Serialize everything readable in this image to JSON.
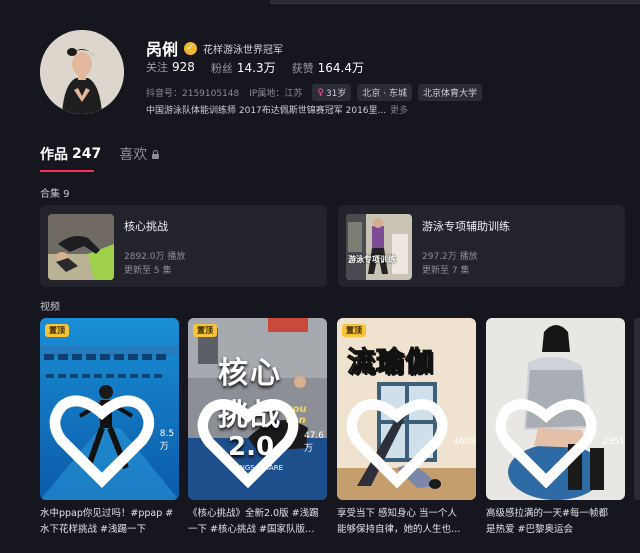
{
  "profile": {
    "name": "呙俐",
    "verified_text": "花样游泳世界冠军",
    "stats": [
      {
        "label": "关注",
        "value": "928"
      },
      {
        "label": "粉丝",
        "value": "14.3万"
      },
      {
        "label": "获赞",
        "value": "164.4万"
      }
    ],
    "douyin_id": "抖音号：2159105148",
    "ip_location": "IP属地：江苏",
    "chips": [
      "31岁",
      "北京 · 东城",
      "北京体育大学"
    ],
    "bio": "中国游泳队体能训练师 2017布达佩斯世锦赛冠军 2016里...",
    "bio_more": "更多"
  },
  "tabs": [
    {
      "label": "作品",
      "count": "247",
      "active": true
    },
    {
      "label": "喜欢",
      "locked": true
    }
  ],
  "collections_label": "合集 9",
  "collections": [
    {
      "title": "核心挑战",
      "views": "2892.0万 播放",
      "update": "更新至 5 集"
    },
    {
      "title": "游泳专项辅助训练",
      "views": "297.2万 播放",
      "update": "更新至 7 集",
      "thumb_text": "游泳专项训练"
    }
  ],
  "videos_label": "视频",
  "pin_label": "置顶",
  "videos": [
    {
      "pinned": true,
      "likes": "8.5万",
      "caption": [
        "水中ppap你见过吗！#ppap #",
        "水下花样挑战 #浅踢一下"
      ]
    },
    {
      "pinned": true,
      "likes": "47.6万",
      "caption": [
        "《核心挑战》全新2.0版 #浅踢",
        "一下 #核心挑战 #国家队版…"
      ],
      "overlay_line1": "核心",
      "overlay_line2": "挑战",
      "overlay_version": "2.0",
      "overlay_small": "THINGS/ SHARE",
      "overlay_script": "you can"
    },
    {
      "pinned": true,
      "likes": "4608",
      "caption": [
        "享受当下 感知身心 当一个人",
        "能够保持自律，她的人生也…"
      ],
      "overlay_title": "流瑜伽"
    },
    {
      "pinned": false,
      "likes": "2351",
      "caption": [
        "高级感拉满的一天#每一帧都",
        "是热爱 #巴黎奥运会"
      ]
    }
  ],
  "colors": {
    "accent": "#fe2c55",
    "badge": "#f6c33a",
    "background": "#16161e",
    "card": "#23232c"
  }
}
